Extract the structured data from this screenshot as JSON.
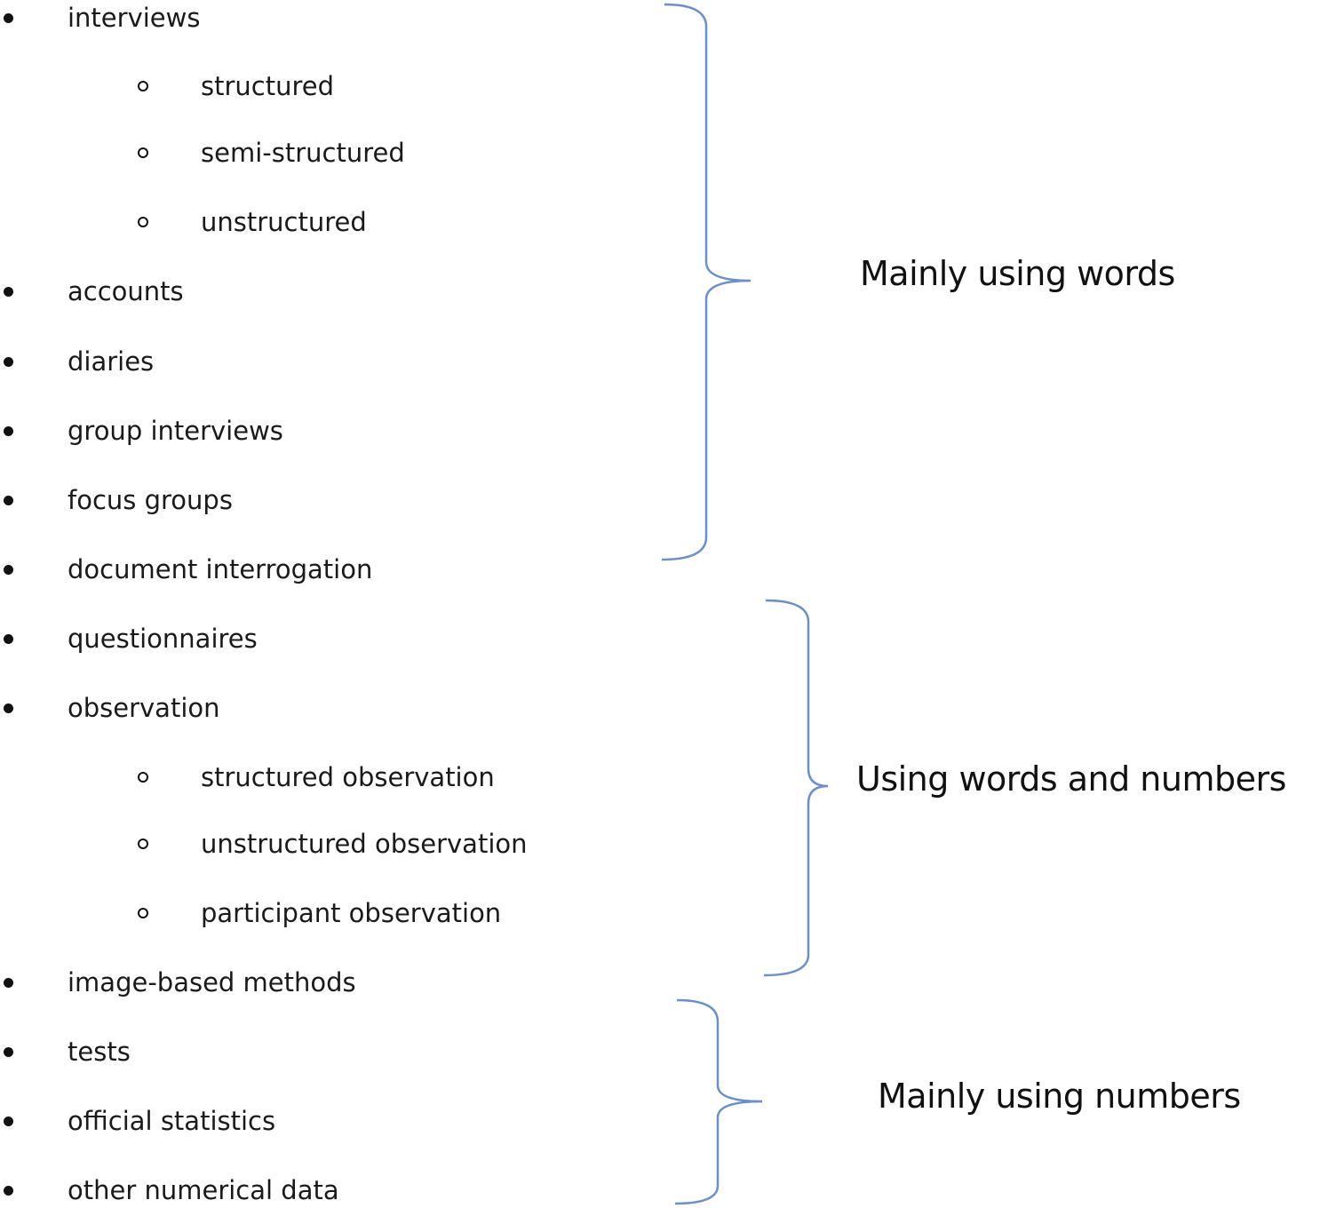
{
  "items": [
    {
      "text": "interviews",
      "level": 1
    },
    {
      "text": "structured",
      "level": 2
    },
    {
      "text": "semi-structured",
      "level": 2
    },
    {
      "text": "unstructured",
      "level": 2
    },
    {
      "text": "accounts",
      "level": 1
    },
    {
      "text": "diaries",
      "level": 1
    },
    {
      "text": "group interviews",
      "level": 1
    },
    {
      "text": "focus groups",
      "level": 1
    },
    {
      "text": "document interrogation",
      "level": 1
    },
    {
      "text": "questionnaires",
      "level": 1
    },
    {
      "text": "observation",
      "level": 1
    },
    {
      "text": "structured observation",
      "level": 2
    },
    {
      "text": "unstructured observation",
      "level": 2
    },
    {
      "text": "participant observation",
      "level": 2
    },
    {
      "text": "image-based methods",
      "level": 1
    },
    {
      "text": "tests",
      "level": 1
    },
    {
      "text": "official statistics",
      "level": 1
    },
    {
      "text": "other numerical data",
      "level": 1
    }
  ],
  "groups": [
    {
      "label": "Mainly using words"
    },
    {
      "label": "Using words and numbers"
    },
    {
      "label": "Mainly using numbers"
    }
  ],
  "brace_color": "#6a90cc"
}
